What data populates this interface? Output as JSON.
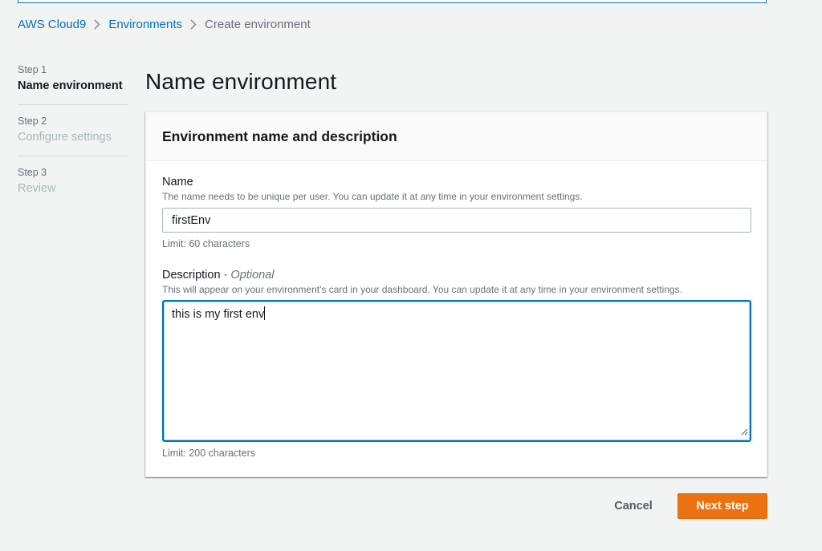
{
  "breadcrumb": {
    "items": [
      {
        "label": "AWS Cloud9"
      },
      {
        "label": "Environments"
      },
      {
        "label": "Create environment"
      }
    ]
  },
  "steps": [
    {
      "number": "Step 1",
      "title": "Name environment",
      "active": true
    },
    {
      "number": "Step 2",
      "title": "Configure settings",
      "active": false
    },
    {
      "number": "Step 3",
      "title": "Review",
      "active": false
    }
  ],
  "page": {
    "title": "Name environment"
  },
  "panel": {
    "title": "Environment name and description",
    "name_field": {
      "label": "Name",
      "help": "The name needs to be unique per user. You can update it at any time in your environment settings.",
      "value": "firstEnv",
      "limit": "Limit: 60 characters"
    },
    "description_field": {
      "label": "Description",
      "optional": "- Optional",
      "help": "This will appear on your environment's card in your dashboard. You can update it at any time in your environment settings.",
      "value": "this is my first env",
      "limit": "Limit: 200 characters"
    }
  },
  "actions": {
    "cancel_label": "Cancel",
    "next_label": "Next step"
  },
  "colors": {
    "link": "#0073bb",
    "primary_button": "#ec7211",
    "background": "#f2f3f3"
  },
  "icons": {
    "breadcrumb_separator": "chevron-right-icon",
    "textarea_resize": "resize-grip-icon"
  }
}
